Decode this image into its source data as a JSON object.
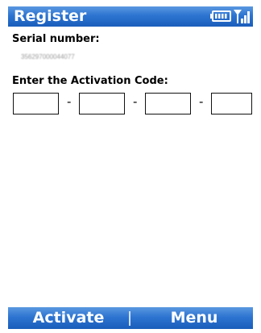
{
  "titlebar": {
    "title": "Register",
    "icons": [
      "battery-icon",
      "signal-icon"
    ]
  },
  "form": {
    "serial_label": "Serial number:",
    "serial_value": "356297000044077",
    "activation_label": "Enter the Activation Code:",
    "code_fields": [
      {
        "value": ""
      },
      {
        "value": ""
      },
      {
        "value": ""
      },
      {
        "value": ""
      }
    ],
    "separator": "-"
  },
  "softkeys": {
    "left": "Activate",
    "right": "Menu"
  },
  "colors": {
    "bar_top": "#5a98e0",
    "bar_bottom": "#1a5dbb",
    "text": "#000000"
  }
}
